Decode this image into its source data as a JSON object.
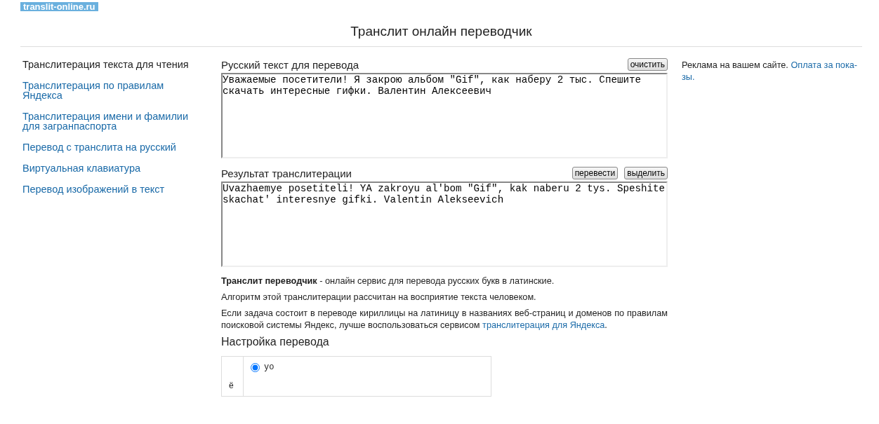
{
  "logo": "translit-online.ru",
  "title": "Транслит онлайн переводчик",
  "sidebar": {
    "items": [
      {
        "label": "Транслитерация текста для чтения",
        "selected": true
      },
      {
        "label": "Транслитерация по правилам Яндекса",
        "selected": false
      },
      {
        "label": "Транслитерация имени и фамилии для загранпаспорта",
        "selected": false
      },
      {
        "label": "Перевод с транслита на русский",
        "selected": false
      },
      {
        "label": "Виртуальная клавиатура",
        "selected": false
      },
      {
        "label": "Перевод изображений в текст",
        "selected": false
      }
    ]
  },
  "source": {
    "label": "Русский текст для перевода",
    "buttons": [
      "очистить"
    ],
    "value": "Уважаемые посетители! Я закрою альбом \"Gif\", как наберу 2 тыс. Спешите скачать интересные гифки. Валентин Алексеевич"
  },
  "result": {
    "label": "Результат транслитерации",
    "buttons": [
      "перевести",
      "выделить"
    ],
    "value": "Uvazhaemye posetiteli! YA zakroyu al'bom \"Gif\", kak naberu 2 tys. Speshite skachat' interesnye gifki. Valentin Alekseevich"
  },
  "description": [
    "**Транслит переводчик** - онлайн сервис для перевода русских букв в латинские.",
    "Алгоритм этой транслитерации рассчитан на восприятие текста человеком."
  ],
  "yandex_note": {
    "text": "Если задача состоит в переводе кириллицы на латиницу в названиях веб-страниц и доменов по правилам поисковой системы Яндекс, лучше воспользоваться сервисом",
    "link": "транслитерация для Яндекса",
    "tail": "."
  },
  "settings": {
    "title": "Настройка перевода",
    "rows": [
      {
        "letter": "ё",
        "options": [
          {
            "label": "yo",
            "selected": true
          }
        ]
      }
    ]
  },
  "ad": {
    "text": "Реклама на вашем сайте.",
    "link_lines": [
      "Оплата за пока-",
      "зы."
    ]
  }
}
